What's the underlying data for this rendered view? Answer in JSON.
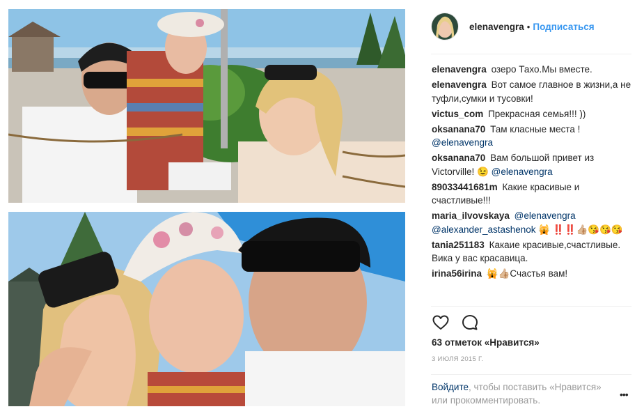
{
  "photos": {
    "top_alt": "",
    "bottom_alt": ""
  },
  "header": {
    "username": "elenavengra",
    "separator": "•",
    "follow_label": "Подписаться",
    "avatar_icon": "profile-avatar"
  },
  "comments": [
    {
      "user": "elenavengra",
      "text": "озеро Тахо.Мы вместе.",
      "mention": ""
    },
    {
      "user": "elenavengra",
      "text": "Вот самое главное в жизни,а не туфли,сумки и тусовки!",
      "mention": ""
    },
    {
      "user": "victus_com",
      "text": "Прекрасная семья!!! ))",
      "mention": ""
    },
    {
      "user": "oksanana70",
      "text": "Там класные места !",
      "mention": "@elenavengra"
    },
    {
      "user": "oksanana70",
      "text": "Вам большой привет из Victorville! 😉",
      "mention": "@elenavengra"
    },
    {
      "user": "89033441681m",
      "text": "Какие красивые и счастливые!!!",
      "mention": ""
    },
    {
      "user": "maria_ilvovskaya",
      "text": "",
      "mention": "@elenavengra @alexander_astashenok",
      "tail": "🙀 ‼️‼️👍🏼😘😘😘"
    },
    {
      "user": "tania251183",
      "text": "Какаие красивые,счастливые. Вика у вас красавица.",
      "mention": ""
    },
    {
      "user": "irina56irina",
      "text": "🙀👍🏼Счастья вам!",
      "mention": ""
    }
  ],
  "actions": {
    "like_icon": "heart-icon",
    "comment_icon": "comment-icon",
    "likes_text": "63 отметок «Нравится»",
    "date_text": "3 ИЮЛЯ 2015 Г."
  },
  "footer": {
    "login_link": "Войдите",
    "login_rest": ", чтобы поставить «Нравится» или прокомментировать.",
    "more_label": "•••"
  },
  "colors": {
    "link_blue": "#3897f0",
    "mention_blue": "#003569",
    "text": "#262626",
    "muted": "#999999",
    "divider": "#efefef"
  }
}
